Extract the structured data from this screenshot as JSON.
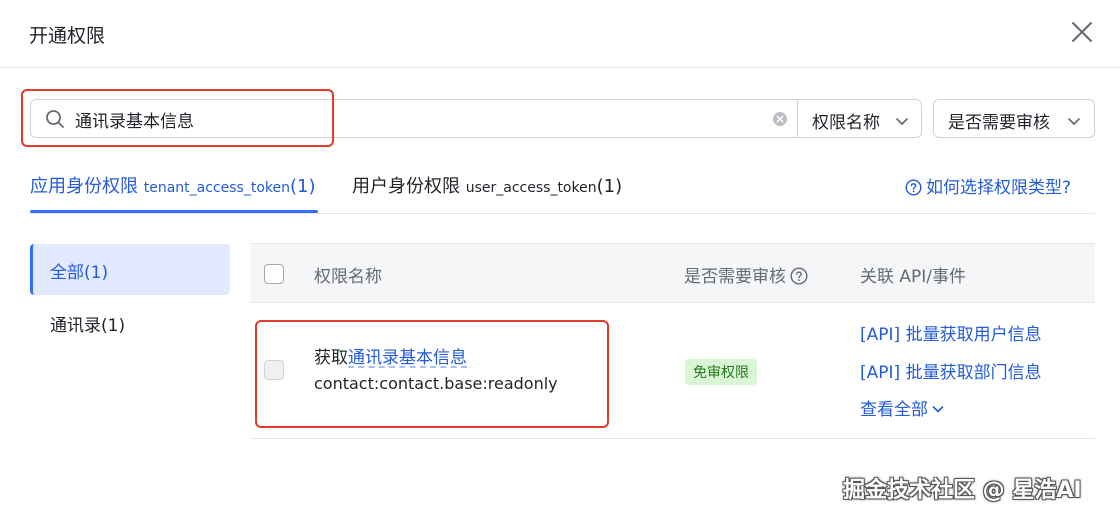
{
  "dialog": {
    "title": "开通权限"
  },
  "search": {
    "value": "通讯录基本信息"
  },
  "filters": {
    "permission_name": "权限名称",
    "needs_review": "是否需要审核"
  },
  "tabs": [
    {
      "label": "应用身份权限",
      "token": "tenant_access_token",
      "count": "(1)",
      "active": true
    },
    {
      "label": "用户身份权限",
      "token": "user_access_token",
      "count": "(1)",
      "active": false
    }
  ],
  "help_link": "如何选择权限类型?",
  "sidebar": {
    "items": [
      {
        "label": "全部(1)",
        "active": true
      },
      {
        "label": "通讯录(1)",
        "active": false
      }
    ]
  },
  "table": {
    "headers": {
      "name": "权限名称",
      "review": "是否需要审核",
      "apis": "关联 API/事件"
    },
    "rows": [
      {
        "prefix": "获取",
        "name_link": "通讯录基本信息",
        "scope": "contact:contact.base:readonly",
        "badge": "免审权限",
        "apis": [
          "[API] 批量获取用户信息",
          "[API] 批量获取部门信息"
        ],
        "view_all": "查看全部"
      }
    ]
  },
  "watermark": "掘金技术社区 @ 星浩AI",
  "colors": {
    "accent": "#3370ff",
    "link": "#245bdb",
    "highlight": "#e03b2b",
    "badge_bg": "#d9f5d6",
    "badge_text": "#237b19"
  }
}
